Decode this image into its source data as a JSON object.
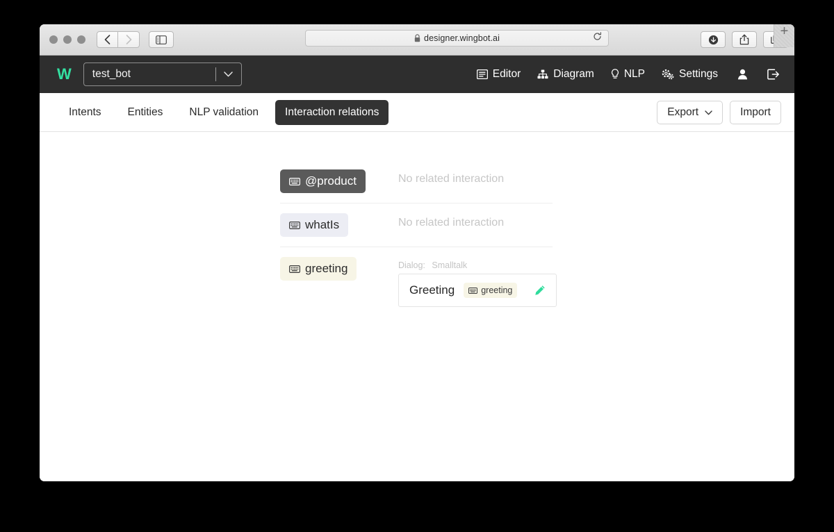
{
  "browser": {
    "url": "designer.wingbot.ai",
    "lock_icon": "lock-icon",
    "back_icon": "chevron-left-icon",
    "forward_icon": "chevron-right-icon",
    "sidebar_icon": "sidebar-toggle-icon",
    "reload_icon": "reload-icon",
    "download_icon": "download-icon",
    "share_icon": "share-icon",
    "tabs_icon": "show-tabs-icon",
    "new_tab_label": "+"
  },
  "header": {
    "logo": "W",
    "logo_color": "#33e0a1",
    "bot_name": "test_bot",
    "caret_icon": "chevron-down-icon",
    "nav": [
      {
        "label": "Editor",
        "icon": "editor-list-icon"
      },
      {
        "label": "Diagram",
        "icon": "sitemap-icon"
      },
      {
        "label": "NLP",
        "icon": "lightbulb-icon"
      },
      {
        "label": "Settings",
        "icon": "gears-icon"
      }
    ],
    "user_icon": "user-icon",
    "logout_icon": "logout-icon"
  },
  "tabs": {
    "items": [
      {
        "label": "Intents",
        "active": false
      },
      {
        "label": "Entities",
        "active": false
      },
      {
        "label": "NLP validation",
        "active": false
      },
      {
        "label": "Interaction relations",
        "active": true
      }
    ],
    "export_label": "Export",
    "export_caret_icon": "chevron-down-icon",
    "import_label": "Import"
  },
  "relations": [
    {
      "entity": "@product",
      "entity_icon": "keyboard-icon",
      "style": "dark",
      "empty_text": "No related interaction",
      "has_card": false
    },
    {
      "entity": "whatIs",
      "entity_icon": "keyboard-icon",
      "style": "lilac",
      "empty_text": "No related interaction",
      "has_card": false
    },
    {
      "entity": "greeting",
      "entity_icon": "keyboard-icon",
      "style": "cream",
      "has_card": true,
      "dialog_label": "Dialog:",
      "dialog_name": "Smalltalk",
      "card_title": "Greeting",
      "card_badge": "greeting",
      "card_badge_icon": "keyboard-icon",
      "edit_icon": "pencil-icon",
      "edit_icon_color": "#2fdc9c"
    }
  ]
}
